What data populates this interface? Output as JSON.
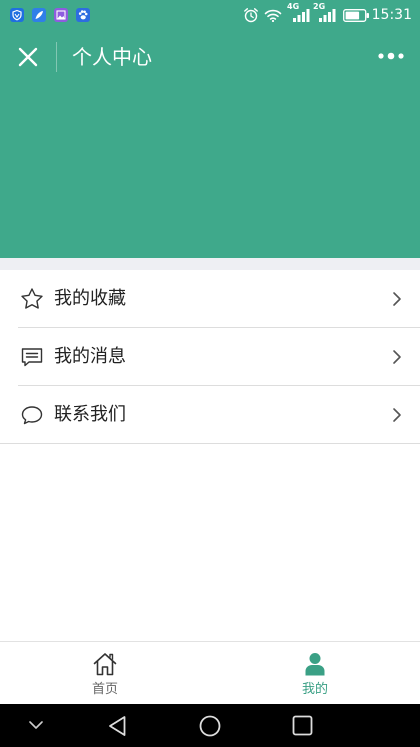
{
  "status_bar": {
    "app_icons": [
      "shield-app-icon",
      "feather-app-icon",
      "gallery-app-icon",
      "paw-app-icon"
    ],
    "alarm_icon": "alarm-icon",
    "wifi_icon": "wifi-icon",
    "network_1": "4G",
    "network_2": "2G",
    "battery_level": 0.75,
    "time": "15:31"
  },
  "header": {
    "close_icon": "close-icon",
    "title": "个人中心",
    "more_icon": "more-icon"
  },
  "menu": {
    "items": [
      {
        "icon": "star-icon",
        "label": "我的收藏"
      },
      {
        "icon": "message-icon",
        "label": "我的消息"
      },
      {
        "icon": "chat-bubble-icon",
        "label": "联系我们"
      }
    ]
  },
  "tabbar": {
    "tabs": [
      {
        "icon": "home-icon",
        "label": "首页",
        "active": false
      },
      {
        "icon": "person-icon",
        "label": "我的",
        "active": true
      }
    ]
  },
  "system_nav": {
    "buttons": [
      "chevron-down-icon",
      "back-icon",
      "home-circle-icon",
      "recents-icon"
    ]
  },
  "colors": {
    "primary": "#3fa98b",
    "strip": "#eeeff3",
    "menu_text": "#222222",
    "tab_active": "#3aa085",
    "tab_inactive": "#666666",
    "divider": "#dddddd",
    "system_nav_bg": "#000000"
  }
}
